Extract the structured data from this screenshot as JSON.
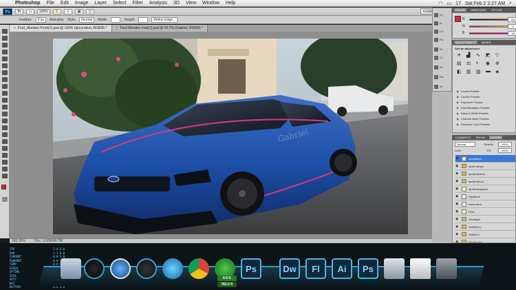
{
  "menubar": {
    "items": [
      "Photoshop",
      "File",
      "Edit",
      "Image",
      "Layer",
      "Select",
      "Filter",
      "Analysis",
      "3D",
      "View",
      "Window",
      "Help"
    ],
    "battery": "17",
    "clock": "Sat Feb 2  2:27 AM"
  },
  "appbar": {
    "logo": "Ps",
    "zoom": "165%",
    "essentials": "ESSENTIALS"
  },
  "optbar": {
    "feather_label": "Feather:",
    "feather_value": "0 px",
    "antialias": "Anti-alias",
    "style_label": "Style:",
    "style_value": "Normal",
    "width_label": "Width:",
    "height_label": "Height:",
    "refine": "Refine Edge..."
  },
  "tabs": [
    {
      "label": "Ford_Mondeo Front(1).psd @ 165% (decoration, RGB/8) *",
      "close": "×"
    },
    {
      "label": "Ford Mondeo mod(1).psd @ 66.7% (Gabriel, RGB/8) *",
      "close": "×"
    }
  ],
  "doctitle": "Ford_Mondeo Front(1).psd @ 165% (decoration, RGB/8) *",
  "canvas_text": {
    "sign": "Gabriel"
  },
  "status": {
    "zoom": "165.05%",
    "doc": "Doc: 1.02M/40.7M"
  },
  "color_panel": {
    "tabs": [
      "COLOR",
      "SWATCHES",
      "STYLES"
    ],
    "fg_color": "#e0222a",
    "channels": [
      {
        "label": "R",
        "value": "224"
      },
      {
        "label": "G",
        "value": "0"
      },
      {
        "label": "B",
        "value": "38"
      }
    ]
  },
  "adjustments": {
    "tabs": [
      "ADJUSTMENTS",
      "MASKS"
    ],
    "hint": "Add an adjustment",
    "presets": [
      "Levels Presets",
      "Curves Presets",
      "Exposure Presets",
      "Hue/Saturation Presets",
      "Black & White Presets",
      "Channel Mixer Presets",
      "Selective Color Presets"
    ]
  },
  "layers_panel": {
    "tabs": [
      "CHANNELS",
      "PATHS",
      "LAYERS"
    ],
    "blend_mode": "Normal",
    "opacity_label": "Opacity:",
    "opacity": "100%",
    "lock_label": "Lock:",
    "fill_label": "Fill:",
    "fill": "100%",
    "layers": [
      {
        "name": "decoration",
        "kind": "layer",
        "selected": true
      },
      {
        "name": "spare lamps",
        "kind": "folder",
        "selected": false
      },
      {
        "name": "spoiler(black)",
        "kind": "folder",
        "selected": false
      },
      {
        "name": "spoiler(blue)",
        "kind": "folder",
        "selected": false
      },
      {
        "name": "spoiler(support)",
        "kind": "layer",
        "selected": false
      },
      {
        "name": "Signature",
        "kind": "layer",
        "selected": false
      },
      {
        "name": "windowtint",
        "kind": "layer",
        "selected": false
      },
      {
        "name": "Rims",
        "kind": "layer",
        "selected": false
      },
      {
        "name": "Headlight",
        "kind": "folder",
        "selected": false
      },
      {
        "name": "Grill(Blue)",
        "kind": "folder",
        "selected": false
      },
      {
        "name": "Sidesk.rt",
        "kind": "folder",
        "selected": false
      },
      {
        "name": "BkgFender",
        "kind": "folder",
        "selected": false
      }
    ]
  },
  "sysmon": [
    {
      "label": "CPU",
      "value": "5.0 G.0"
    },
    {
      "label": "RAM",
      "value": "2.1 G.0"
    },
    {
      "label": "CURRENT",
      "value": "0.0 1.0"
    },
    {
      "label": "POWERED",
      "value": "0.0 1.0"
    },
    {
      "label": "TEMP",
      "value": "0.0 0.0"
    },
    {
      "label": "SPEED",
      "value": "0.0 0.0"
    },
    {
      "label": "UPTIME",
      "value": "0.0 0.0"
    },
    {
      "label": "DISK",
      "value": "0.0 0.0"
    },
    {
      "label": "WIFI",
      "value": "0.0 0.0"
    },
    {
      "label": "NET",
      "value": "0.0 0.0"
    },
    {
      "label": "BATTERY",
      "value": "0.0 0.0"
    }
  ],
  "dock": {
    "netmeter_up": "0.9 K",
    "netmeter_down": "782.6 K",
    "apps": [
      {
        "name": "finder-icon",
        "label": ""
      },
      {
        "name": "dashboard-icon",
        "label": ""
      },
      {
        "name": "safari-icon",
        "label": ""
      },
      {
        "name": "itunes-icon",
        "label": ""
      },
      {
        "name": "system-preferences-icon",
        "label": ""
      },
      {
        "name": "chrome-icon",
        "label": ""
      },
      {
        "name": "utorrent-icon",
        "label": ""
      },
      {
        "name": "photoshop-icon",
        "label": "Ps"
      },
      {
        "name": "dreamweaver-icon",
        "label": "Dw"
      },
      {
        "name": "flash-icon",
        "label": "Fl"
      },
      {
        "name": "illustrator-icon",
        "label": "Ai"
      },
      {
        "name": "photoshop2-icon",
        "label": "Ps"
      },
      {
        "name": "disk-icon",
        "label": ""
      },
      {
        "name": "textedit-icon",
        "label": ""
      },
      {
        "name": "trash-icon",
        "label": ""
      }
    ]
  }
}
